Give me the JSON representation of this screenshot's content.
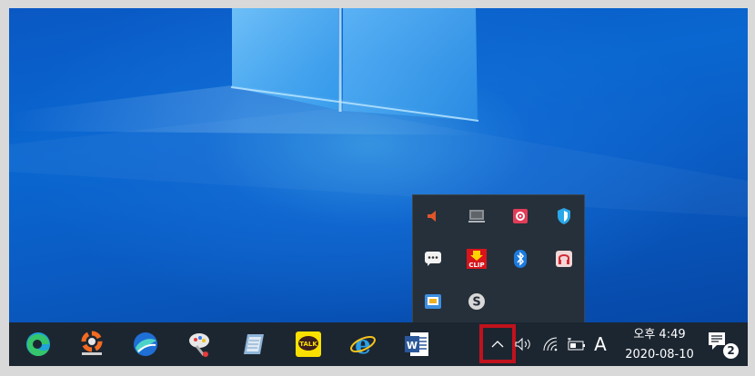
{
  "taskbar": {
    "pinned_apps": [
      {
        "name": "Microsoft Edge",
        "icon": "edge-icon"
      },
      {
        "name": "PhotoScape",
        "icon": "photoscape-icon"
      },
      {
        "name": "Internet browser",
        "icon": "browser-icon"
      },
      {
        "name": "Snipping / Paint tool",
        "icon": "paint-tool-icon"
      },
      {
        "name": "Notepad / document",
        "icon": "notepad-icon"
      },
      {
        "name": "KakaoTalk",
        "icon": "kakaotalk-icon",
        "label": "TALK"
      },
      {
        "name": "Internet Explorer",
        "icon": "internet-explorer-icon"
      },
      {
        "name": "Microsoft Word",
        "icon": "word-icon"
      }
    ],
    "system_tray": {
      "input_indicator": "A",
      "clock": {
        "time": "오후 4:49",
        "date": "2020-08-10"
      },
      "notification_count": "2"
    }
  },
  "tray_flyout": {
    "icons": [
      "speaker-muted-icon",
      "monitor-icon",
      "app-settings-icon",
      "security-shield-icon",
      "chat-bubble-icon",
      "clip-download-icon",
      "bluetooth-icon",
      "headset-icon",
      "remote-app-icon",
      "skype-icon"
    ],
    "clip_label": "CLIP"
  },
  "colors": {
    "desktop": "#0a5cc4",
    "taskbar": "#1c2631",
    "flyout": "#26303a",
    "highlight": "#c0121c"
  }
}
